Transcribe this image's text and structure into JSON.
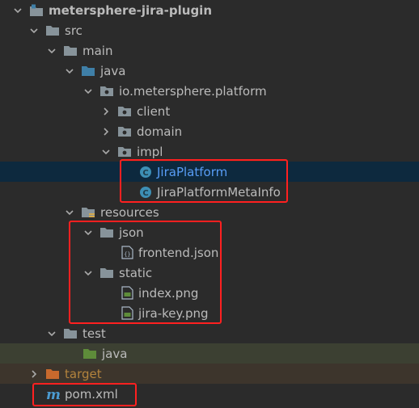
{
  "tree": {
    "root": "metersphere-jira-plugin",
    "src": "src",
    "main": "main",
    "java": "java",
    "package": "io.metersphere.platform",
    "client": "client",
    "domain": "domain",
    "impl": "impl",
    "jira_platform": "JiraPlatform",
    "jira_platform_meta_info": "JiraPlatformMetaInfo",
    "resources": "resources",
    "json_dir": "json",
    "frontend_json": "frontend.json",
    "static_dir": "static",
    "index_png": "index.png",
    "jira_key_png": "jira-key.png",
    "test": "test",
    "test_java": "java",
    "target": "target",
    "pom": "pom.xml",
    "pom_icon_letter": "m"
  },
  "colors": {
    "selection": "#0d293e",
    "highlight_border": "#ff2020",
    "class_icon": "#3d8fb5",
    "folder": "#87939a",
    "source_folder": "#3f7fa7",
    "test_folder": "#5e8c3a",
    "excluded_folder": "#c8692d"
  }
}
